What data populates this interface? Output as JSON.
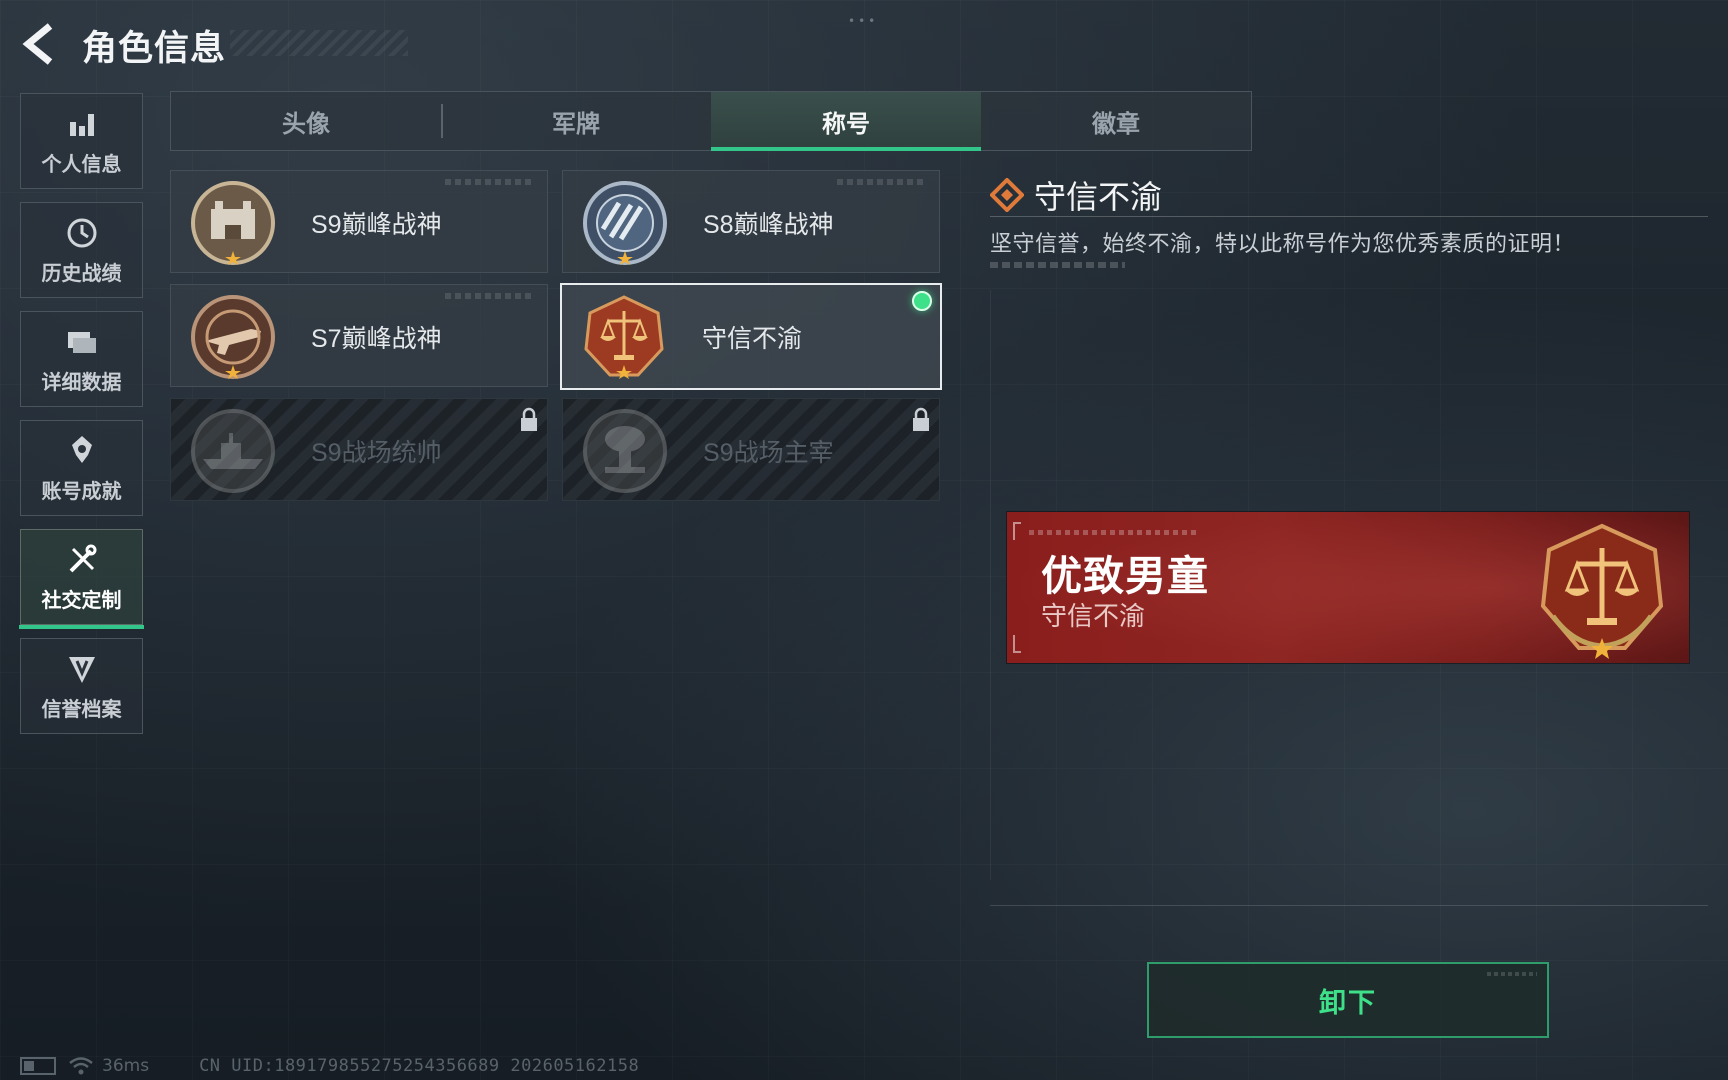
{
  "header": {
    "title": "角色信息",
    "back_icon": "back-arrow-icon"
  },
  "sidebar": {
    "items": [
      {
        "label": "个人信息",
        "icon": "bar-chart-icon",
        "active": false
      },
      {
        "label": "历史战绩",
        "icon": "history-clock-icon",
        "active": false
      },
      {
        "label": "详细数据",
        "icon": "folder-stack-icon",
        "active": false
      },
      {
        "label": "账号成就",
        "icon": "achievement-medal-icon",
        "active": false
      },
      {
        "label": "社交定制",
        "icon": "tools-icon",
        "active": true
      },
      {
        "label": "信誉档案",
        "icon": "reputation-shield-icon",
        "active": false
      }
    ]
  },
  "tabs": [
    {
      "label": "头像",
      "active": false
    },
    {
      "label": "军牌",
      "active": false
    },
    {
      "label": "称号",
      "active": true
    },
    {
      "label": "徽章",
      "active": false
    }
  ],
  "titles": [
    {
      "name": "S9巅峰战神",
      "emblem": "fortress-emblem-icon",
      "locked": false,
      "selected": false
    },
    {
      "name": "S8巅峰战神",
      "emblem": "striped-globe-emblem-icon",
      "locked": false,
      "selected": false
    },
    {
      "name": "S7巅峰战神",
      "emblem": "rifle-emblem-icon",
      "locked": false,
      "selected": false
    },
    {
      "name": "守信不渝",
      "emblem": "scales-emblem-icon",
      "locked": false,
      "selected": true,
      "equipped": true
    },
    {
      "name": "S9战场统帅",
      "emblem": "warship-emblem-icon",
      "locked": true,
      "selected": false
    },
    {
      "name": "S9战场主宰",
      "emblem": "mushroom-cloud-emblem-icon",
      "locked": true,
      "selected": false
    }
  ],
  "detail": {
    "title": "守信不渝",
    "description": "坚守信誉，始终不渝，特以此称号作为您优秀素质的证明！"
  },
  "preview": {
    "player_name": "优致男童",
    "title": "守信不渝",
    "emblem": "scales-emblem-icon"
  },
  "actions": {
    "unequip_label": "卸下"
  },
  "footer": {
    "ping": "36ms",
    "uid": "CN UID:18917985527525435​6689 202605162158"
  },
  "colors": {
    "accent_green": "#33c68a",
    "status_dot": "#3fe08a",
    "banner_red": "#8a1e1c",
    "title_icon_orange": "#e07a3a"
  }
}
